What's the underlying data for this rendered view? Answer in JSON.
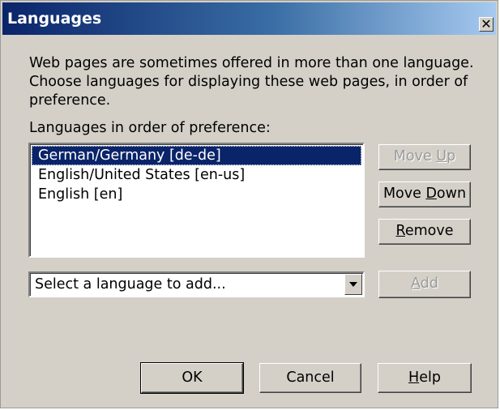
{
  "window": {
    "title": "Languages",
    "close_glyph": "✕"
  },
  "main": {
    "description": "Web pages are sometimes offered in more than one language. Choose languages for displaying these web pages, in order of preference.",
    "list_label": "Languages in order of preference:",
    "languages": [
      {
        "label": "German/Germany  [de-de]",
        "selected": true
      },
      {
        "label": "English/United States  [en-us]",
        "selected": false
      },
      {
        "label": "English  [en]",
        "selected": false
      }
    ]
  },
  "buttons": {
    "move_up": {
      "pre": "Move ",
      "mnemonic": "U",
      "post": "p",
      "enabled": false
    },
    "move_down": {
      "pre": "Move ",
      "mnemonic": "D",
      "post": "own",
      "enabled": true
    },
    "remove": {
      "pre": "",
      "mnemonic": "R",
      "post": "emove",
      "enabled": true
    },
    "add": {
      "pre": "",
      "mnemonic": "A",
      "post": "dd",
      "enabled": false
    },
    "ok": "OK",
    "cancel": "Cancel",
    "help": {
      "pre": "",
      "mnemonic": "H",
      "post": "elp",
      "enabled": true
    }
  },
  "add_select": {
    "value": "Select a language to add..."
  },
  "colors": {
    "title_start": "#0a246a",
    "selection": "#0a246a",
    "face": "#d4d0c8"
  }
}
